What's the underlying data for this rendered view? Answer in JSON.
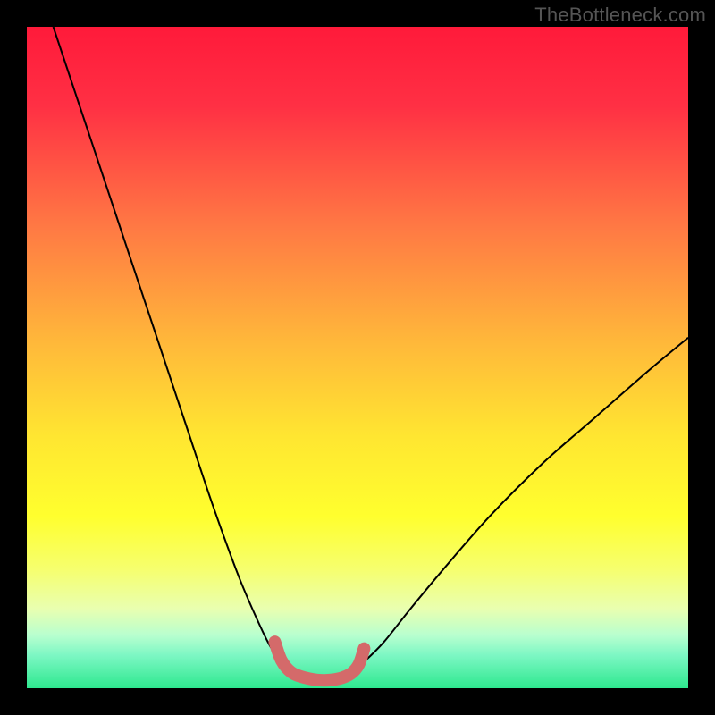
{
  "watermark": "TheBottleneck.com",
  "chart_data": {
    "type": "line",
    "title": "",
    "xlabel": "",
    "ylabel": "",
    "xlim": [
      0,
      100
    ],
    "ylim": [
      0,
      100
    ],
    "background_gradient": {
      "stops": [
        {
          "pos": 0.0,
          "color": "#ff1a3a"
        },
        {
          "pos": 0.12,
          "color": "#ff3044"
        },
        {
          "pos": 0.3,
          "color": "#ff7844"
        },
        {
          "pos": 0.48,
          "color": "#ffb93a"
        },
        {
          "pos": 0.62,
          "color": "#ffe631"
        },
        {
          "pos": 0.74,
          "color": "#ffff2e"
        },
        {
          "pos": 0.82,
          "color": "#f6ff6e"
        },
        {
          "pos": 0.88,
          "color": "#e9ffb0"
        },
        {
          "pos": 0.92,
          "color": "#b8ffcf"
        },
        {
          "pos": 0.95,
          "color": "#7df7c4"
        },
        {
          "pos": 1.0,
          "color": "#2ee88f"
        }
      ]
    },
    "series": [
      {
        "name": "bottleneck-curve",
        "color": "#000000",
        "stroke_width": 2,
        "points": [
          {
            "x": 4,
            "y": 100
          },
          {
            "x": 8,
            "y": 88
          },
          {
            "x": 12,
            "y": 76
          },
          {
            "x": 16,
            "y": 64
          },
          {
            "x": 20,
            "y": 52
          },
          {
            "x": 24,
            "y": 40
          },
          {
            "x": 28,
            "y": 28
          },
          {
            "x": 32,
            "y": 17
          },
          {
            "x": 35,
            "y": 10
          },
          {
            "x": 37,
            "y": 6
          },
          {
            "x": 39,
            "y": 3.5
          },
          {
            "x": 41,
            "y": 2.2
          },
          {
            "x": 43,
            "y": 1.6
          },
          {
            "x": 45,
            "y": 1.4
          },
          {
            "x": 47,
            "y": 1.6
          },
          {
            "x": 49,
            "y": 2.4
          },
          {
            "x": 51,
            "y": 4
          },
          {
            "x": 54,
            "y": 7
          },
          {
            "x": 58,
            "y": 12
          },
          {
            "x": 63,
            "y": 18
          },
          {
            "x": 70,
            "y": 26
          },
          {
            "x": 78,
            "y": 34
          },
          {
            "x": 86,
            "y": 41
          },
          {
            "x": 94,
            "y": 48
          },
          {
            "x": 100,
            "y": 53
          }
        ]
      },
      {
        "name": "highlight-marker",
        "color": "#d46a6a",
        "stroke_width": 14,
        "linecap": "round",
        "points": [
          {
            "x": 37.5,
            "y": 7.0
          },
          {
            "x": 38.5,
            "y": 4.2
          },
          {
            "x": 40.0,
            "y": 2.4
          },
          {
            "x": 42.0,
            "y": 1.6
          },
          {
            "x": 44.5,
            "y": 1.2
          },
          {
            "x": 47.0,
            "y": 1.4
          },
          {
            "x": 49.0,
            "y": 2.2
          },
          {
            "x": 50.2,
            "y": 3.6
          },
          {
            "x": 51.0,
            "y": 6.0
          }
        ]
      }
    ],
    "annotations": []
  }
}
